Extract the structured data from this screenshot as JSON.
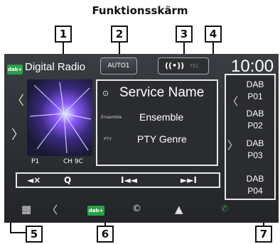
{
  "caption": "Funktionsskärm",
  "callouts": [
    "1",
    "2",
    "3",
    "4",
    "5",
    "6",
    "7"
  ],
  "header": {
    "source_logo": "dab+",
    "source_label": "Digital Radio",
    "auto_button": "AUTO1",
    "antenna": "((•))",
    "tel": "TEL",
    "clock": "10:00"
  },
  "left_panel": {
    "preset": "P1",
    "channel": "CH 9C"
  },
  "info": {
    "service_name": "Service Name",
    "ensemble_label": "Ensemble",
    "ensemble": "Ensemble",
    "pty_label": "PTY",
    "pty_genre": "PTY Genre"
  },
  "controls": [
    "◄×",
    "Q",
    "I◄◄",
    "►►I"
  ],
  "presets": [
    {
      "band": "DAB",
      "num": "P01"
    },
    {
      "band": "DAB",
      "num": "P02"
    },
    {
      "band": "DAB",
      "num": "P03"
    },
    {
      "band": "DAB",
      "num": "P04"
    }
  ],
  "bottom_bar": {
    "menu_icon": "grid-icon",
    "back_icon": "chevron-left-icon",
    "dab_label": "dab+",
    "c_icon": "c-icon",
    "nav_icon": "navigation-arrow-icon"
  }
}
